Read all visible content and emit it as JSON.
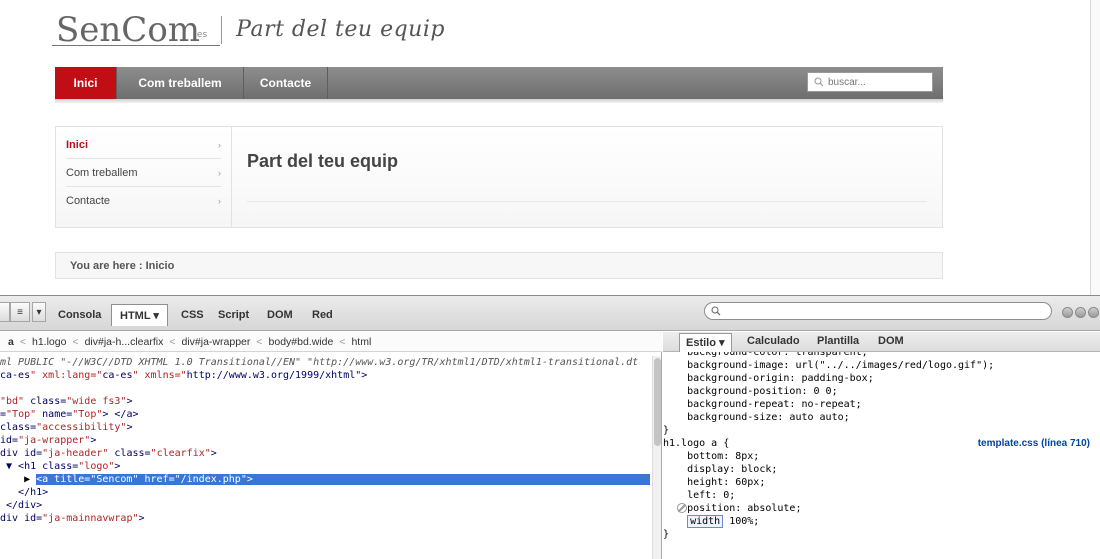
{
  "site": {
    "logo_text": "SenCom",
    "logo_small": ".es",
    "tagline": "Part del teu equip",
    "nav": [
      "Inici",
      "Com treballem",
      "Contacte"
    ],
    "search_placeholder": "buscar...",
    "side_menu": [
      {
        "label": "Inici",
        "active": true
      },
      {
        "label": "Com treballem",
        "active": false
      },
      {
        "label": "Contacte",
        "active": false
      }
    ],
    "chevron": "›",
    "page_title": "Part del teu equip",
    "breadcrumb": "You are here :  Inicio",
    "accent_color": "#c10e14"
  },
  "firebug": {
    "tabs": [
      "Consola",
      "HTML ▾",
      "CSS",
      "Script",
      "DOM",
      "Red"
    ],
    "selected_tab": "HTML ▾",
    "path": [
      "a",
      "h1.logo",
      "div#ja-h...clearfix",
      "div#ja-wrapper",
      "body#bd.wide",
      "html"
    ],
    "path_sep": "<",
    "html_lines": [
      [
        "kw",
        "ml PUBLIC \"-//W3C//DTD XHTML 1.0 Transitional//EN\" \"http://www.w3.org/TR/xhtml1/DTD/xhtml1-transitional.dt"
      ],
      [
        "mix",
        "ca-es\" xml:lang=\"ca-es\" xmlns=\"http://www.w3.org/1999/xhtml\">"
      ],
      [
        "blank",
        ""
      ],
      [
        "mix",
        "\"bd\" class=\"wide fs3\">"
      ],
      [
        "mix",
        "=\"Top\" name=\"Top\"> </a>"
      ],
      [
        "mix",
        "class=\"accessibility\">"
      ],
      [
        "mix",
        "id=\"ja-wrapper\">"
      ],
      [
        "mix",
        "div id=\"ja-header\" class=\"clearfix\">"
      ],
      [
        "mix",
        " ▼ <h1 class=\"logo\">"
      ],
      [
        "sel",
        "    ▶ <a title=\"Sencom\" href=\"/index.php\">"
      ],
      [
        "mix",
        "   </h1>"
      ],
      [
        "mix",
        " </div>"
      ],
      [
        "mix",
        "div id=\"ja-mainnavwrap\">"
      ]
    ],
    "right_tabs": [
      "Estilo ▾",
      "Calculado",
      "Plantilla",
      "DOM"
    ],
    "css_lines": [
      "    background-color: transparent;",
      "    background-image: url(\"../../images/red/logo.gif\");",
      "    background-origin: padding-box;",
      "    background-position: 0 0;",
      "    background-repeat: no-repeat;",
      "    background-size: auto auto;",
      "}",
      "h1.logo a {",
      "    bottom: 8px;",
      "    display: block;",
      "    height: 60px;",
      "    left: 0;",
      "    position: absolute;",
      "    width",
      "}"
    ],
    "css_width_value": "100%;",
    "css_source_link": "template.css (línea 710)"
  }
}
